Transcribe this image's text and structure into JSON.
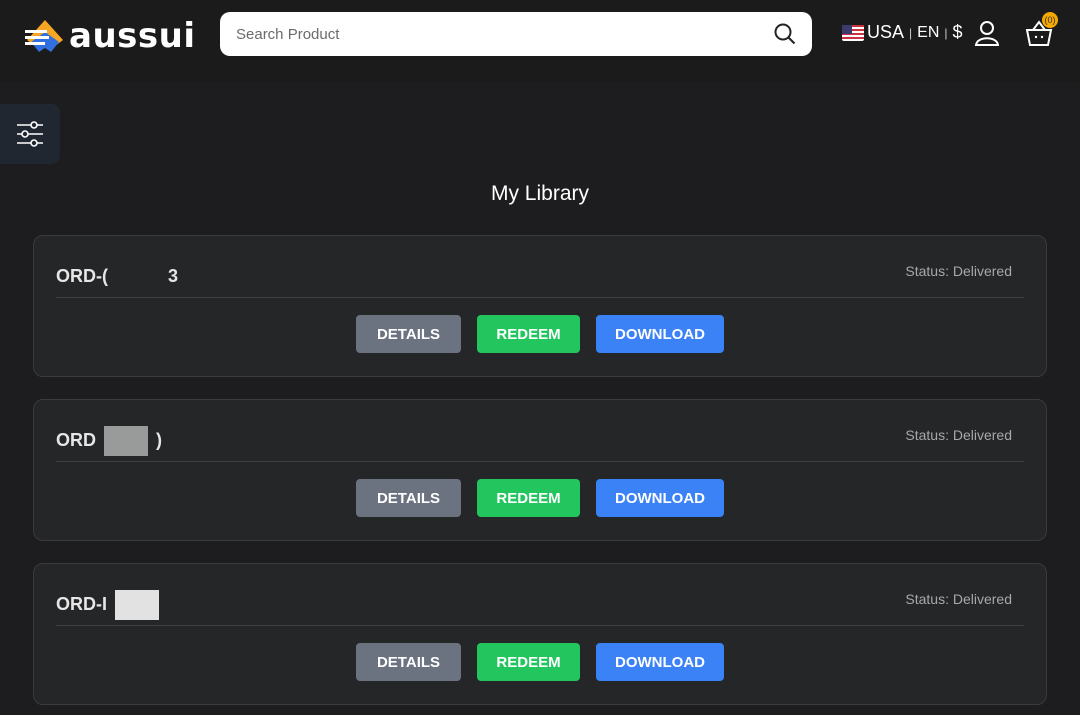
{
  "header": {
    "brand": "aussui",
    "search_placeholder": "Search Product",
    "country": "USA",
    "language": "EN",
    "currency": "$",
    "cart_count": "(0)"
  },
  "page": {
    "title": "My Library"
  },
  "orders": [
    {
      "id_prefix": "ORD-(",
      "id_suffix": "3",
      "status": "Status: Delivered",
      "details": "DETAILS",
      "redeem": "REDEEM",
      "download": "DOWNLOAD"
    },
    {
      "id_prefix": "ORD",
      "id_suffix": ")",
      "status": "Status: Delivered",
      "details": "DETAILS",
      "redeem": "REDEEM",
      "download": "DOWNLOAD"
    },
    {
      "id_prefix": "ORD-I",
      "id_suffix": "",
      "status": "Status: Delivered",
      "details": "DETAILS",
      "redeem": "REDEEM",
      "download": "DOWNLOAD"
    }
  ]
}
